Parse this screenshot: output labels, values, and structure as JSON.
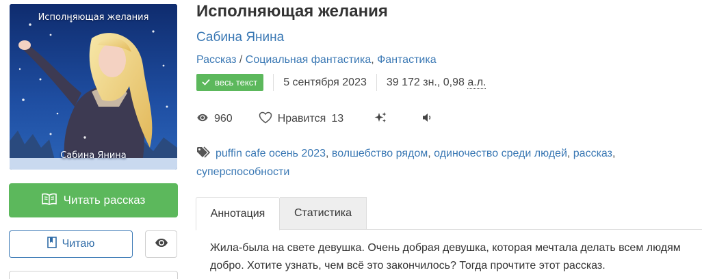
{
  "cover": {
    "title": "Исполняющая желания",
    "author": "Сабина Янина"
  },
  "book": {
    "title": "Исполняющая желания",
    "author": "Сабина Янина",
    "genres": {
      "first": "Рассказ",
      "second": "Социальная фантастика",
      "third": "Фантастика",
      "slash": " / ",
      "comma": ", "
    },
    "badge_label": "весь текст",
    "date": "5 сентября 2023",
    "size_main": "39 172 зн., 0,98 ",
    "size_unit": "а.л."
  },
  "stats": {
    "views": "960",
    "likes_label": "Нравится",
    "likes_count": "13"
  },
  "tags": [
    "puffin cafe осень 2023",
    "волшебство рядом",
    "одиночество среди людей",
    "рассказ",
    "суперспособности"
  ],
  "buttons": {
    "read": "Читать рассказ",
    "reading": "Читаю"
  },
  "tabs": {
    "annotation": "Аннотация",
    "statistics": "Статистика"
  },
  "annotation_text": "Жила-была на свете девушка. Очень добрая девушка, которая мечтала делать всем людям добро. Хотите узнать, чем всё это закончилось? Тогда прочтите этот рассказ.",
  "colors": {
    "green": "#5cb85c",
    "link": "#3a78b4",
    "tab_inactive": "#eeeeee"
  },
  "icons": [
    "open-book-icon",
    "bookmark-icon",
    "eye-icon",
    "heart-icon",
    "sparkles-icon",
    "speaker-icon",
    "tag-icon",
    "check-icon"
  ]
}
